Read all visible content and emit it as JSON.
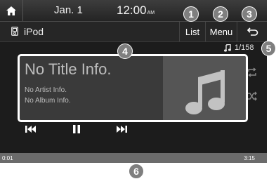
{
  "status_bar": {
    "date": "Jan.  1",
    "time": "12:00",
    "ampm": "AM"
  },
  "header": {
    "source_label": "iPod",
    "list_label": "List",
    "menu_label": "Menu",
    "back_icon": "back-arrow-icon"
  },
  "track": {
    "counter": "1/158",
    "title": "No Title Info.",
    "artist": "No Artist Info.",
    "album": "No Album Info."
  },
  "playback": {
    "elapsed": "0:01",
    "total": "3:15",
    "progress_fraction": 0.0
  },
  "callouts": [
    "1",
    "2",
    "3",
    "4",
    "5",
    "6"
  ],
  "colors": {
    "screen_bg": "#1c1c1c",
    "callout_bg": "#7f7f7f",
    "info_box_border": "#ffffff",
    "progress_bar": "#6b6b6b"
  }
}
